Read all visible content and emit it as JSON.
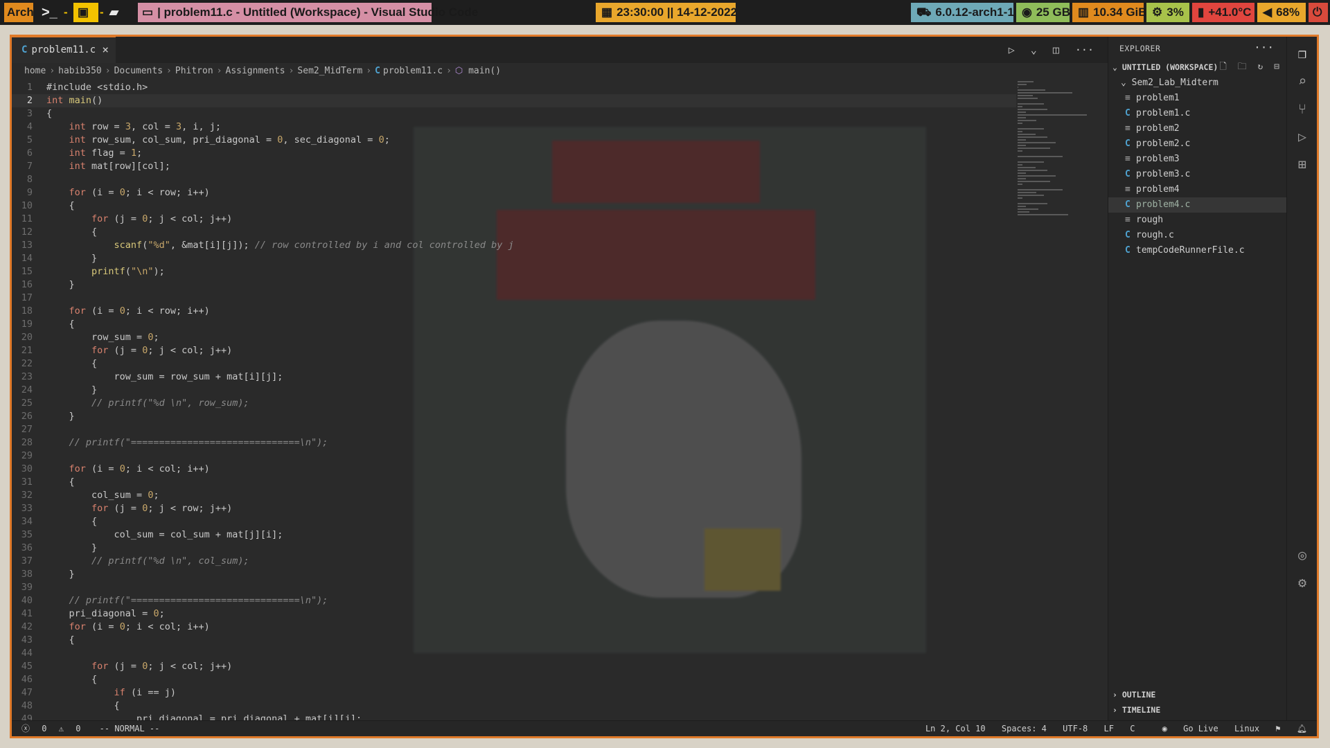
{
  "topbar": {
    "arch_label": "Arch",
    "terminal_glyph": ">_",
    "dash": "-",
    "window_title": "| problem11.c - Untitled (Workspace) - Visual Studio Code",
    "clock": "23:30:00 || 14-12-2022",
    "kernel": "6.0.12-arch1-1",
    "disk": "25 GB",
    "ram": "10.34 GiB",
    "cpu": "3%",
    "temp": "+41.0°C",
    "volume": "68%"
  },
  "editor": {
    "tab_label": "problem11.c",
    "breadcrumb": [
      "home",
      "habib350",
      "Documents",
      "Phitron",
      "Assignments",
      "Sem2_MidTerm",
      "problem11.c",
      "main()"
    ]
  },
  "explorer": {
    "title": "EXPLORER",
    "workspace": "UNTITLED (WORKSPACE)",
    "folder": "Sem2_Lab_Midterm",
    "files": [
      {
        "name": "problem1",
        "type": "bin"
      },
      {
        "name": "problem1.c",
        "type": "c"
      },
      {
        "name": "problem2",
        "type": "bin"
      },
      {
        "name": "problem2.c",
        "type": "c"
      },
      {
        "name": "problem3",
        "type": "bin"
      },
      {
        "name": "problem3.c",
        "type": "c"
      },
      {
        "name": "problem4",
        "type": "bin"
      },
      {
        "name": "problem4.c",
        "type": "c",
        "active": true
      },
      {
        "name": "rough",
        "type": "bin"
      },
      {
        "name": "rough.c",
        "type": "c"
      },
      {
        "name": "tempCodeRunnerFile.c",
        "type": "c"
      }
    ],
    "outline": "OUTLINE",
    "timeline": "TIMELINE"
  },
  "statusbar": {
    "errors": "0",
    "warnings": "0",
    "mode": "-- NORMAL --",
    "position": "Ln 2, Col 10",
    "spaces": "Spaces: 4",
    "encoding": "UTF-8",
    "eol": "LF",
    "language": "C",
    "golive": "Go Live",
    "os": "Linux"
  },
  "code_lines": [
    "#include <stdio.h>",
    "int main()",
    "{",
    "    int row = 3, col = 3, i, j;",
    "    int row_sum, col_sum, pri_diagonal = 0, sec_diagonal = 0;",
    "    int flag = 1;",
    "    int mat[row][col];",
    "",
    "    for (i = 0; i < row; i++)",
    "    {",
    "        for (j = 0; j < col; j++)",
    "        {",
    "            scanf(\"%d\", &mat[i][j]); // row controlled by i and col controlled by j",
    "        }",
    "        printf(\"\\n\");",
    "    }",
    "",
    "    for (i = 0; i < row; i++)",
    "    {",
    "        row_sum = 0;",
    "        for (j = 0; j < col; j++)",
    "        {",
    "            row_sum = row_sum + mat[i][j];",
    "        }",
    "        // printf(\"%d \\n\", row_sum);",
    "    }",
    "",
    "    // printf(\"==============================\\n\");",
    "",
    "    for (i = 0; i < col; i++)",
    "    {",
    "        col_sum = 0;",
    "        for (j = 0; j < row; j++)",
    "        {",
    "            col_sum = col_sum + mat[j][i];",
    "        }",
    "        // printf(\"%d \\n\", col_sum);",
    "    }",
    "",
    "    // printf(\"==============================\\n\");",
    "    pri_diagonal = 0;",
    "    for (i = 0; i < col; i++)",
    "    {",
    "",
    "        for (j = 0; j < col; j++)",
    "        {",
    "            if (i == j)",
    "            {",
    "                pri_diagonal = pri_diagonal + mat[i][j];"
  ],
  "current_line": 2
}
